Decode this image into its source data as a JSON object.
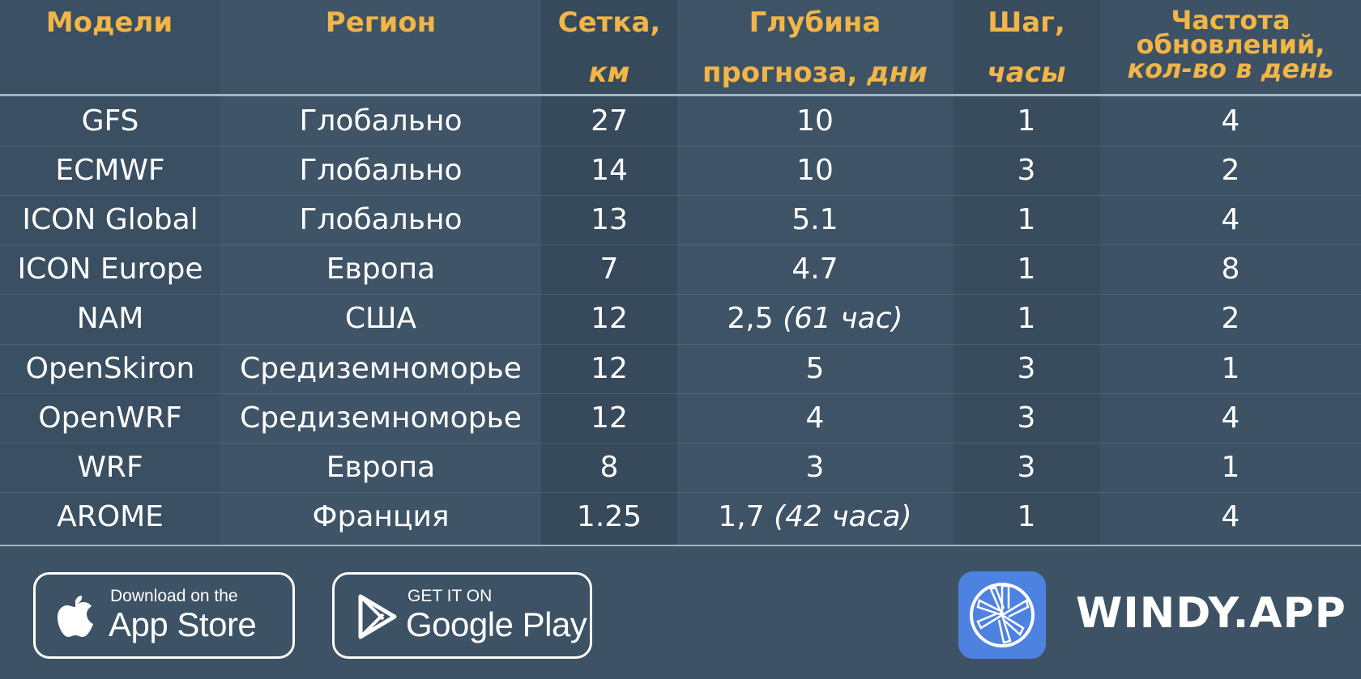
{
  "table": {
    "headers": {
      "model": "Модели",
      "region": "Регион",
      "grid_line1": "Сетка,",
      "grid_line2": "км",
      "depth_line1": "Глубина",
      "depth_line2a": "прогноза,",
      "depth_line2b": "дни",
      "step_line1": "Шаг,",
      "step_line2": "часы",
      "freq_line1": "Частота",
      "freq_line2": "обновлений,",
      "freq_line3": "кол-во в день"
    },
    "rows": [
      {
        "model": "GFS",
        "region": "Глобально",
        "grid": "27",
        "depth": "10",
        "depth_note": "",
        "step": "1",
        "freq": "4"
      },
      {
        "model": "ECMWF",
        "region": "Глобально",
        "grid": "14",
        "depth": "10",
        "depth_note": "",
        "step": "3",
        "freq": "2"
      },
      {
        "model": "ICON Global",
        "region": "Глобально",
        "grid": "13",
        "depth": "5.1",
        "depth_note": "",
        "step": "1",
        "freq": "4"
      },
      {
        "model": "ICON Europe",
        "region": "Европа",
        "grid": "7",
        "depth": "4.7",
        "depth_note": "",
        "step": "1",
        "freq": "8"
      },
      {
        "model": "NAM",
        "region": "США",
        "grid": "12",
        "depth": "2,5",
        "depth_note": "(61 час)",
        "step": "1",
        "freq": "2"
      },
      {
        "model": "OpenSkiron",
        "region": "Средиземноморье",
        "grid": "12",
        "depth": "5",
        "depth_note": "",
        "step": "3",
        "freq": "1"
      },
      {
        "model": "OpenWRF",
        "region": "Средиземноморье",
        "grid": "12",
        "depth": "4",
        "depth_note": "",
        "step": "3",
        "freq": "4"
      },
      {
        "model": "WRF",
        "region": "Европа",
        "grid": "8",
        "depth": "3",
        "depth_note": "",
        "step": "3",
        "freq": "1"
      },
      {
        "model": "AROME",
        "region": "Франция",
        "grid": "1.25",
        "depth": "1,7",
        "depth_note": "(42 часа)",
        "step": "1",
        "freq": "4"
      }
    ]
  },
  "footer": {
    "app_store": {
      "small": "Download on the",
      "big": "App Store",
      "icon": "apple-icon"
    },
    "google_play": {
      "small": "GET IT ON",
      "big": "Google Play",
      "icon": "google-play-icon"
    },
    "brand": "WINDY.APP",
    "logo_icon": "windy-logo-icon"
  },
  "colors": {
    "background": "#3d5264",
    "header_text": "#f1b548",
    "logo_blue": "#4e82e0"
  }
}
